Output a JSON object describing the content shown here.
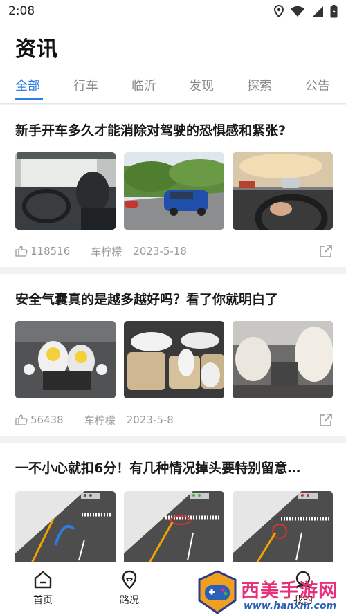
{
  "status_bar": {
    "time": "2:08"
  },
  "header": {
    "title": "资讯"
  },
  "tabs": [
    {
      "label": "全部",
      "active": true
    },
    {
      "label": "行车",
      "active": false
    },
    {
      "label": "临沂",
      "active": false
    },
    {
      "label": "发现",
      "active": false
    },
    {
      "label": "探索",
      "active": false
    },
    {
      "label": "公告",
      "active": false
    }
  ],
  "articles": [
    {
      "title": "新手开车多久才能消除对驾驶的恐惧感和紧张?",
      "views": "118516",
      "author": "车柠檬",
      "date": "2023-5-18",
      "thumbs": [
        "driver-cabin-photo",
        "suv-on-road-photo",
        "steering-wheel-photo"
      ]
    },
    {
      "title": "安全气囊真的是越多越好吗？看了你就明白了",
      "views": "56438",
      "author": "车柠檬",
      "date": "2023-5-8",
      "thumbs": [
        "crash-test-airbag-photo",
        "car-interior-airbags-photo",
        "deployed-airbag-photo"
      ]
    },
    {
      "title": "一不小心就扣6分！有几种情况掉头要特别留意…",
      "thumbs": [
        "u-turn-diagram-1",
        "u-turn-diagram-2",
        "u-turn-diagram-3"
      ]
    }
  ],
  "bottom_nav": [
    {
      "label": "首页",
      "icon": "home-icon"
    },
    {
      "label": "路况",
      "icon": "location-icon"
    },
    {
      "label": "我的",
      "icon": "profile-icon"
    }
  ],
  "watermark": {
    "text": "西美手游网",
    "url": "www.hanxm.com"
  },
  "colors": {
    "accent": "#2b7de9",
    "background": "#f2f2f2",
    "watermark": "#e8307a"
  }
}
